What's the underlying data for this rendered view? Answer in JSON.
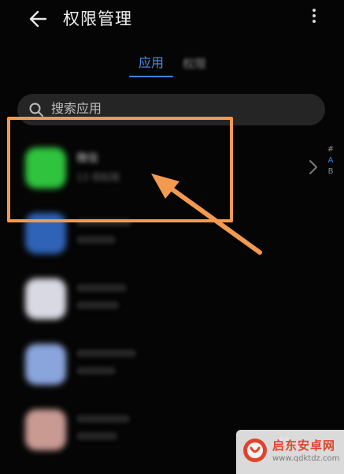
{
  "header": {
    "title": "权限管理"
  },
  "tabs": [
    {
      "label": "应用",
      "selected": true
    },
    {
      "label": "权限",
      "selected": false
    }
  ],
  "search": {
    "placeholder": "搜索应用"
  },
  "apps": [
    {
      "name": "微信",
      "subtitle": "13 项权限",
      "color": "#2fc33e"
    },
    {
      "name": "",
      "subtitle": "",
      "color": "#2f63b7"
    },
    {
      "name": "",
      "subtitle": "",
      "color": "#d9d9e3"
    },
    {
      "name": "",
      "subtitle": "",
      "color": "#8aa4dc"
    },
    {
      "name": "",
      "subtitle": "",
      "color": "#c99a92"
    }
  ],
  "alphabet_index": [
    "#",
    "A",
    "B"
  ],
  "colors": {
    "accent": "#3f85e6",
    "highlight": "#f39a50",
    "background": "#050505"
  },
  "watermark": {
    "title": "启东安卓网",
    "url": "www.qdktdz.com"
  }
}
